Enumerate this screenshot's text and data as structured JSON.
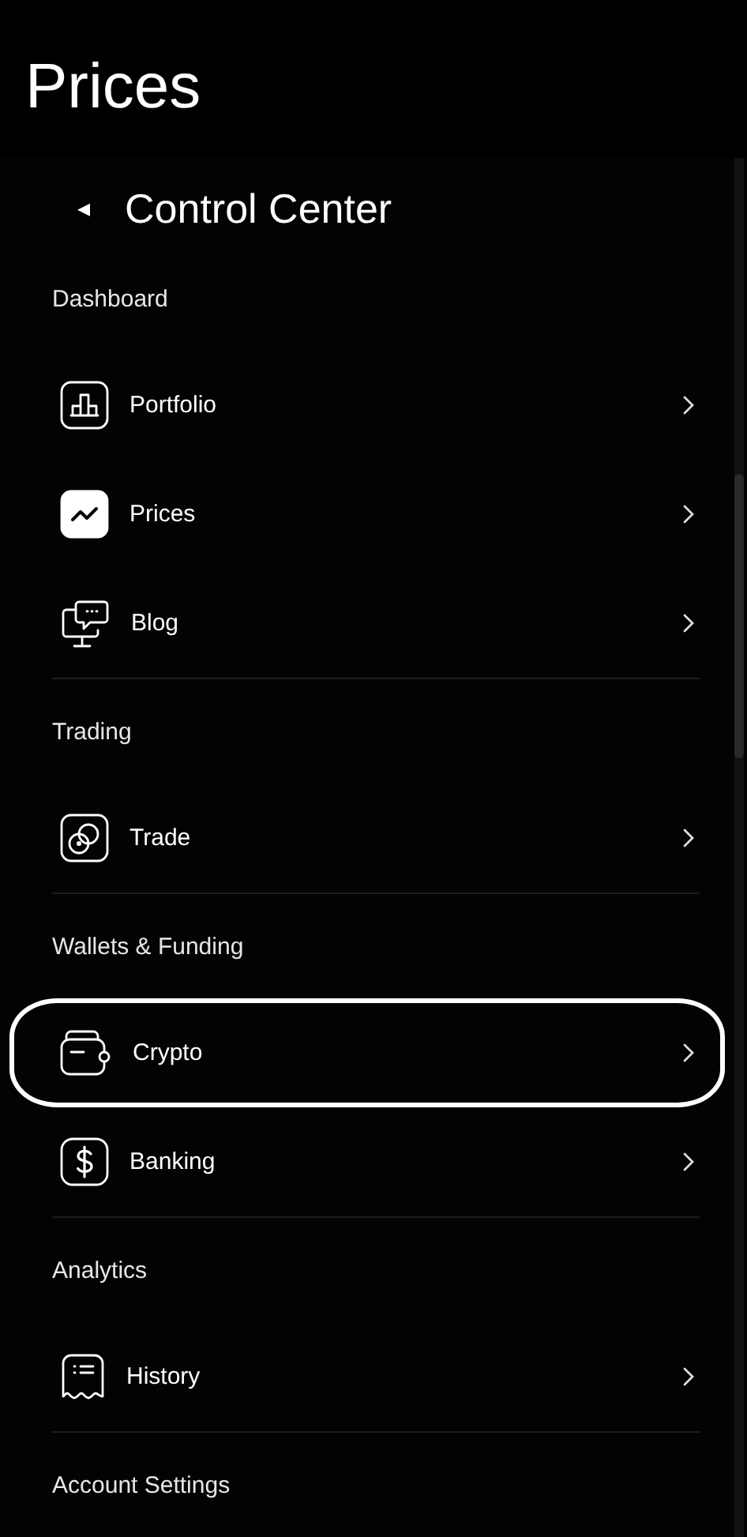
{
  "page_title": "Prices",
  "panel": {
    "back": "◂",
    "title": "Control Center",
    "sections": [
      {
        "label": "Dashboard",
        "items": [
          {
            "label": "Portfolio",
            "selected": false,
            "highlighted": false
          },
          {
            "label": "Prices",
            "selected": true,
            "highlighted": false
          },
          {
            "label": "Blog",
            "selected": false,
            "highlighted": false
          }
        ]
      },
      {
        "label": "Trading",
        "items": [
          {
            "label": "Trade",
            "selected": false,
            "highlighted": false
          }
        ]
      },
      {
        "label": "Wallets & Funding",
        "items": [
          {
            "label": "Crypto",
            "selected": false,
            "highlighted": true
          },
          {
            "label": "Banking",
            "selected": false,
            "highlighted": false
          }
        ]
      },
      {
        "label": "Analytics",
        "items": [
          {
            "label": "History",
            "selected": false,
            "highlighted": false
          }
        ]
      },
      {
        "label": "Account Settings"
      }
    ]
  }
}
